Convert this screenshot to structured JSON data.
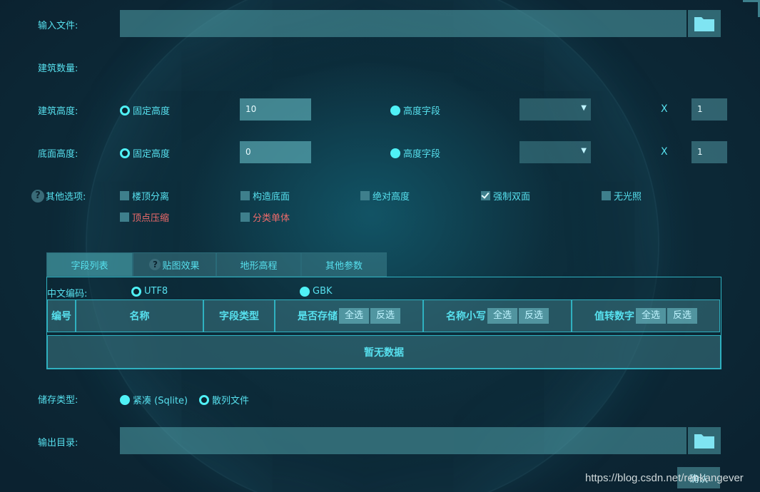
{
  "input_file": {
    "label": "输入文件:"
  },
  "building_count": {
    "label": "建筑数量:"
  },
  "building_height": {
    "label": "建筑高度:",
    "fixed_label": "固定高度",
    "fixed_value": "10",
    "field_label": "高度字段",
    "field_select": "",
    "multiplier_label": "X",
    "multiplier_value": "1"
  },
  "base_height": {
    "label": "底面高度:",
    "fixed_label": "固定高度",
    "fixed_value": "0",
    "field_label": "高度字段",
    "field_select": "",
    "multiplier_label": "X",
    "multiplier_value": "1"
  },
  "other_options": {
    "label": "其他选项:",
    "items": [
      {
        "label": "楼顶分离",
        "checked": false
      },
      {
        "label": "构造底面",
        "checked": false
      },
      {
        "label": "绝对高度",
        "checked": false
      },
      {
        "label": "强制双面",
        "checked": true
      },
      {
        "label": "无光照",
        "checked": false
      },
      {
        "label": "顶点压缩",
        "checked": false,
        "color": "#ef6b6b"
      },
      {
        "label": "分类单体",
        "checked": false,
        "color": "#ef6b6b"
      }
    ]
  },
  "tabs": [
    "字段列表",
    "贴图效果",
    "地形高程",
    "其他参数"
  ],
  "encoding": {
    "label": "中文编码:",
    "utf8": "UTF8",
    "gbk": "GBK"
  },
  "table": {
    "headers": [
      "编号",
      "名称",
      "字段类型",
      "是否存储",
      "名称小写",
      "值转数字"
    ],
    "select_all": "全选",
    "invert": "反选",
    "empty": "暂无数据"
  },
  "storage": {
    "label": "储存类型:",
    "compact": "紧凑 (Sqlite)",
    "hashed": "散列文件"
  },
  "output_dir": {
    "label": "输出目录:"
  },
  "confirm": "确认",
  "watermark": "https://blog.csdn.net/renkangever",
  "colors": {
    "accent": "#57e0ee",
    "warn": "#ef6b6b",
    "background": "#0c2430"
  }
}
